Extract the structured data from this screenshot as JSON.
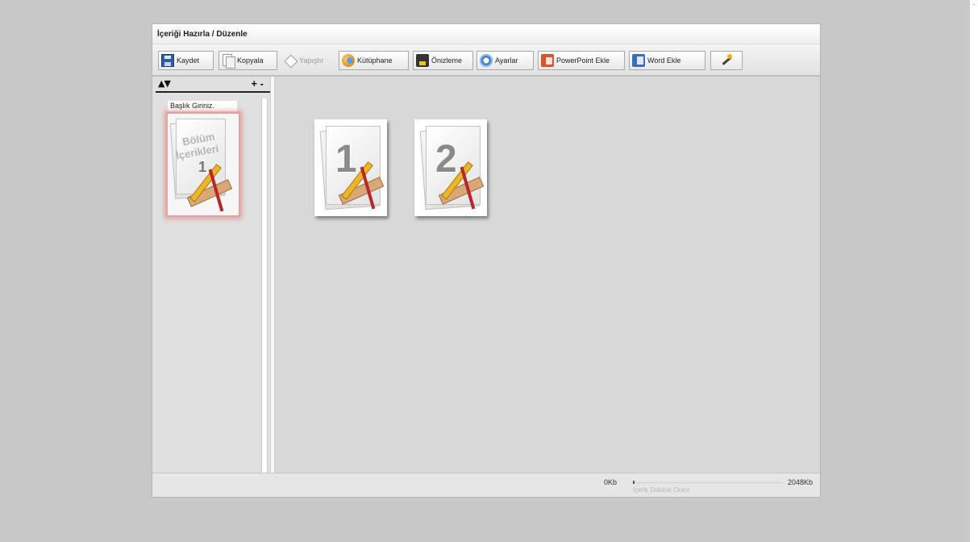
{
  "window": {
    "title": "İçeriği Hazırla / Düzenle"
  },
  "toolbar": {
    "save": "Kaydet",
    "copy": "Kopyala",
    "paste": "Yapıştır",
    "library": "Kütüphane",
    "preview": "Önizleme",
    "settings": "Ayarlar",
    "add_powerpoint": "PowerPoint Ekle",
    "add_word": "Word Ekle"
  },
  "sidebar": {
    "reorder_arrows": "▲▼",
    "add_remove": "+ -",
    "section": {
      "title": "Başlık Giriniz.",
      "thumb_line1": "Bölüm",
      "thumb_line2": "İçerikleri",
      "thumb_number": "1"
    }
  },
  "pages": [
    {
      "number": "1"
    },
    {
      "number": "2"
    }
  ],
  "status": {
    "min_label": "0Kb",
    "max_label": "2048Kb",
    "caption": "İçerik Doluluk Oranı",
    "fill_fraction": 0.0
  },
  "icons": {
    "save": "floppy-disk-icon",
    "copy": "copy-pages-icon",
    "paste": "paste-diamond-icon",
    "library": "library-icon",
    "preview": "phone-preview-icon",
    "settings": "gear-icon",
    "add_powerpoint": "powerpoint-icon",
    "add_word": "word-icon",
    "wizard": "magic-wand-icon"
  }
}
